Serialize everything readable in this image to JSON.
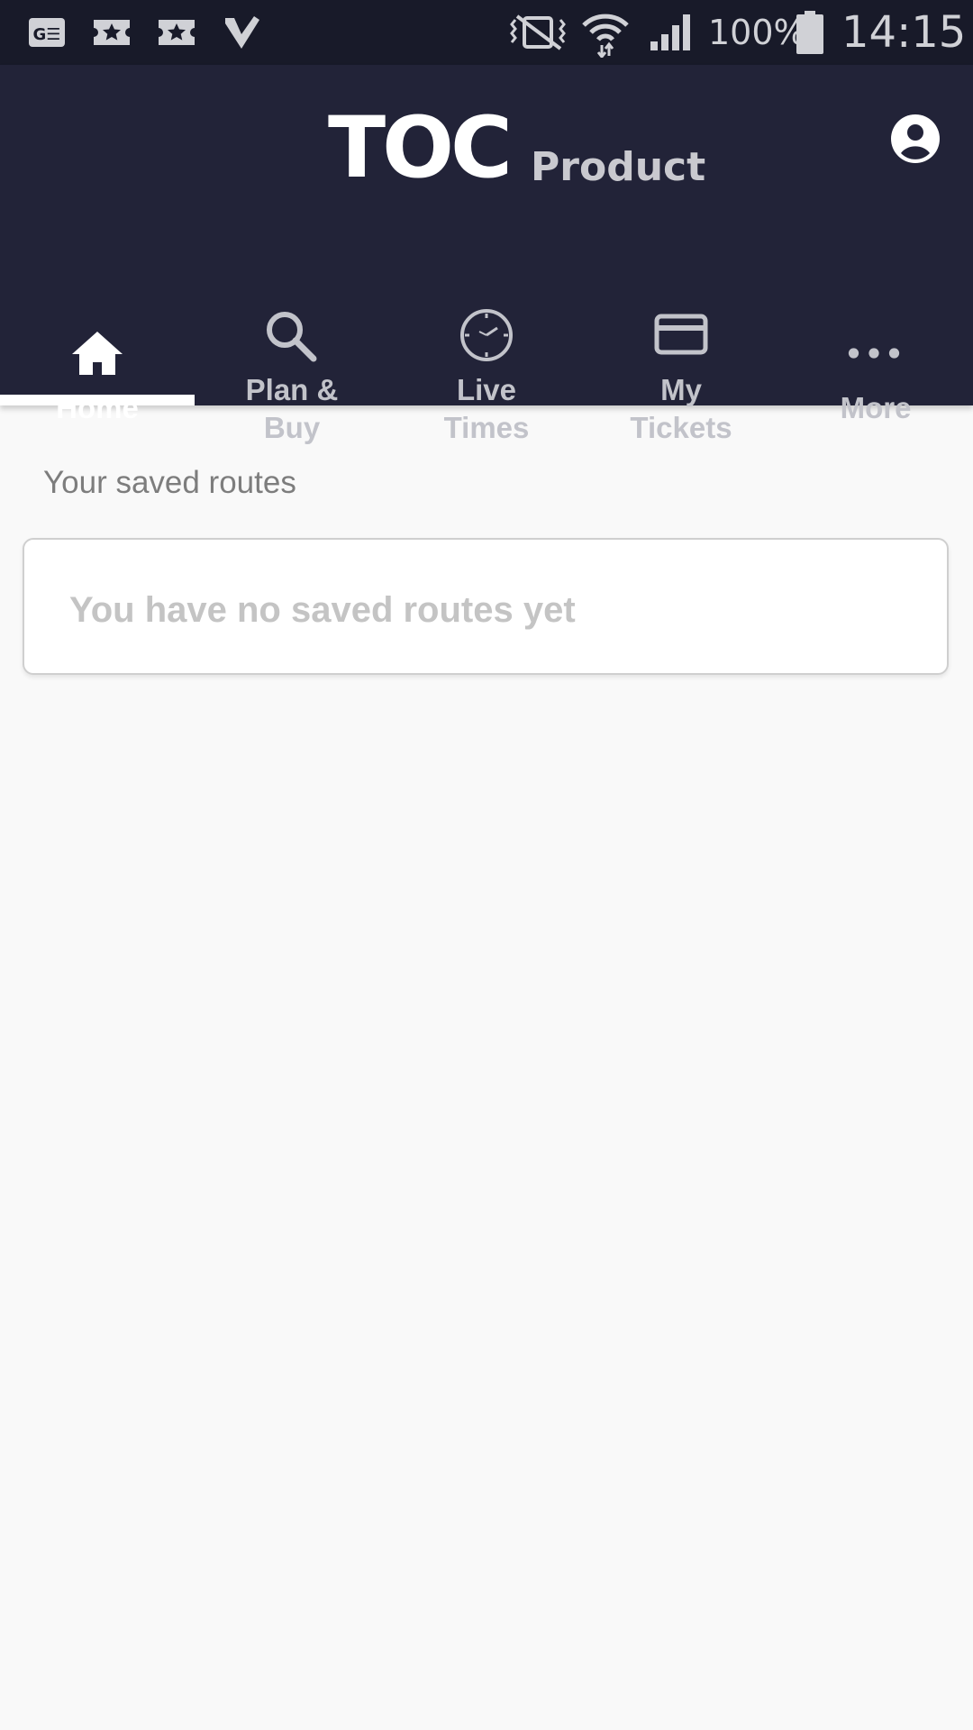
{
  "status_bar": {
    "battery": "100%",
    "time": "14:15",
    "icons": [
      "ge-icon",
      "ticket-icon",
      "ticket-icon",
      "check-icon",
      "vibrate-icon",
      "wifi-icon",
      "signal-icon",
      "battery-icon"
    ]
  },
  "header": {
    "brand": "TOC",
    "product": "Product",
    "account_icon": "account-icon"
  },
  "tabs": [
    {
      "label": "Home",
      "icon": "home-icon",
      "active": true
    },
    {
      "label": "Plan &\nBuy",
      "icon": "search-icon",
      "active": false
    },
    {
      "label": "Live\nTimes",
      "icon": "clock-icon",
      "active": false
    },
    {
      "label": "My\nTickets",
      "icon": "ticket-card-icon",
      "active": false
    },
    {
      "label": "More",
      "icon": "more-icon",
      "active": false
    }
  ],
  "main": {
    "section_title": "Your saved routes",
    "empty_message": "You have no saved routes yet"
  },
  "colors": {
    "status_bar": "#181a29",
    "header": "#222338",
    "background": "#f9f9f9",
    "active_tab": "#ffffff",
    "inactive_tab": "#c2c3ca"
  }
}
